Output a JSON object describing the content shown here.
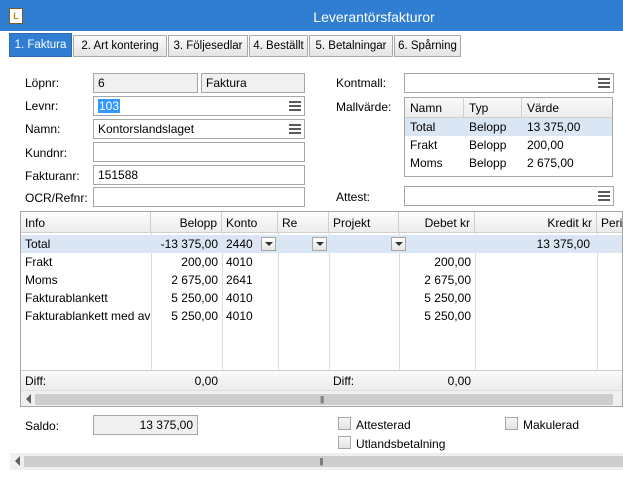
{
  "window": {
    "title": "Leverantörsfakturor"
  },
  "tabs": [
    {
      "label": "1. Faktura"
    },
    {
      "label": "2. Art kontering"
    },
    {
      "label": "3. Följesedlar"
    },
    {
      "label": "4. Beställt"
    },
    {
      "label": "5. Betalningar"
    },
    {
      "label": "6. Spårning"
    }
  ],
  "form": {
    "lopnr_label": "Löpnr:",
    "lopnr_value": "6",
    "type_value": "Faktura",
    "levnr_label": "Levnr:",
    "levnr_value": "103",
    "namn_label": "Namn:",
    "namn_value": "Kontorslandslaget",
    "kundnr_label": "Kundnr:",
    "kundnr_value": "",
    "fakturanr_label": "Fakturanr:",
    "fakturanr_value": "151588",
    "ocr_label": "OCR/Refnr:",
    "ocr_value": "",
    "kontmall_label": "Kontmall:",
    "kontmall_value": "",
    "mallvarde_label": "Mallvärde:",
    "attest_label": "Attest:",
    "attest_value": ""
  },
  "mallvarde_table": {
    "headers": [
      "Namn",
      "Typ",
      "Värde"
    ],
    "rows": [
      {
        "namn": "Total",
        "typ": "Belopp",
        "varde": "13 375,00"
      },
      {
        "namn": "Frakt",
        "typ": "Belopp",
        "varde": "200,00"
      },
      {
        "namn": "Moms",
        "typ": "Belopp",
        "varde": "2 675,00"
      }
    ]
  },
  "grid": {
    "headers": {
      "info": "Info",
      "belopp": "Belopp",
      "konto": "Konto",
      "re": "Re",
      "projekt": "Projekt",
      "debet": "Debet kr",
      "kredit": "Kredit kr",
      "period": "Perio"
    },
    "rows": [
      {
        "info": "Total",
        "belopp": "-13 375,00",
        "konto": "2440",
        "debet": "",
        "kredit": "13 375,00"
      },
      {
        "info": "Frakt",
        "belopp": "200,00",
        "konto": "4010",
        "debet": "200,00",
        "kredit": ""
      },
      {
        "info": "Moms",
        "belopp": "2 675,00",
        "konto": "2641",
        "debet": "2 675,00",
        "kredit": ""
      },
      {
        "info": "Fakturablankett",
        "belopp": "5 250,00",
        "konto": "4010",
        "debet": "5 250,00",
        "kredit": ""
      },
      {
        "info": "Fakturablankett med avi",
        "belopp": "5 250,00",
        "konto": "4010",
        "debet": "5 250,00",
        "kredit": ""
      }
    ],
    "diff_label_left": "Diff:",
    "diff_value_left": "0,00",
    "diff_label_right": "Diff:",
    "diff_value_right": "0,00"
  },
  "bottom": {
    "saldo_label": "Saldo:",
    "saldo_value": "13 375,00",
    "attesterad_label": "Attesterad",
    "utlandsbetalning_label": "Utlandsbetalning",
    "makulerad_label": "Makulerad"
  },
  "colors": {
    "titlebar": "#2f7ed2",
    "active_tab": "#2f7ed2",
    "selection": "#3399ff",
    "row_highlight": "#dbe6f4"
  },
  "icons": {
    "app": "app-document-icon",
    "list": "list-lookup-icon",
    "dropdown": "chevron-down-icon",
    "scroll_grip": "scroll-grip-icon"
  }
}
